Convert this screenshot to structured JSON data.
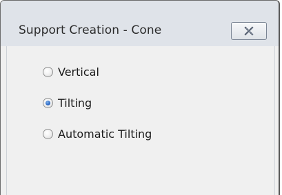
{
  "window": {
    "title": "Support Creation - Cone",
    "close_icon": "close-x-icon"
  },
  "options": [
    {
      "label": "Vertical",
      "checked": false
    },
    {
      "label": "Tilting",
      "checked": true
    },
    {
      "label": "Automatic Tilting",
      "checked": false
    }
  ],
  "colors": {
    "title_bar": "#dfe3e9",
    "client_bg": "#f0f0f0",
    "radio_selected": "#2a67c5"
  }
}
